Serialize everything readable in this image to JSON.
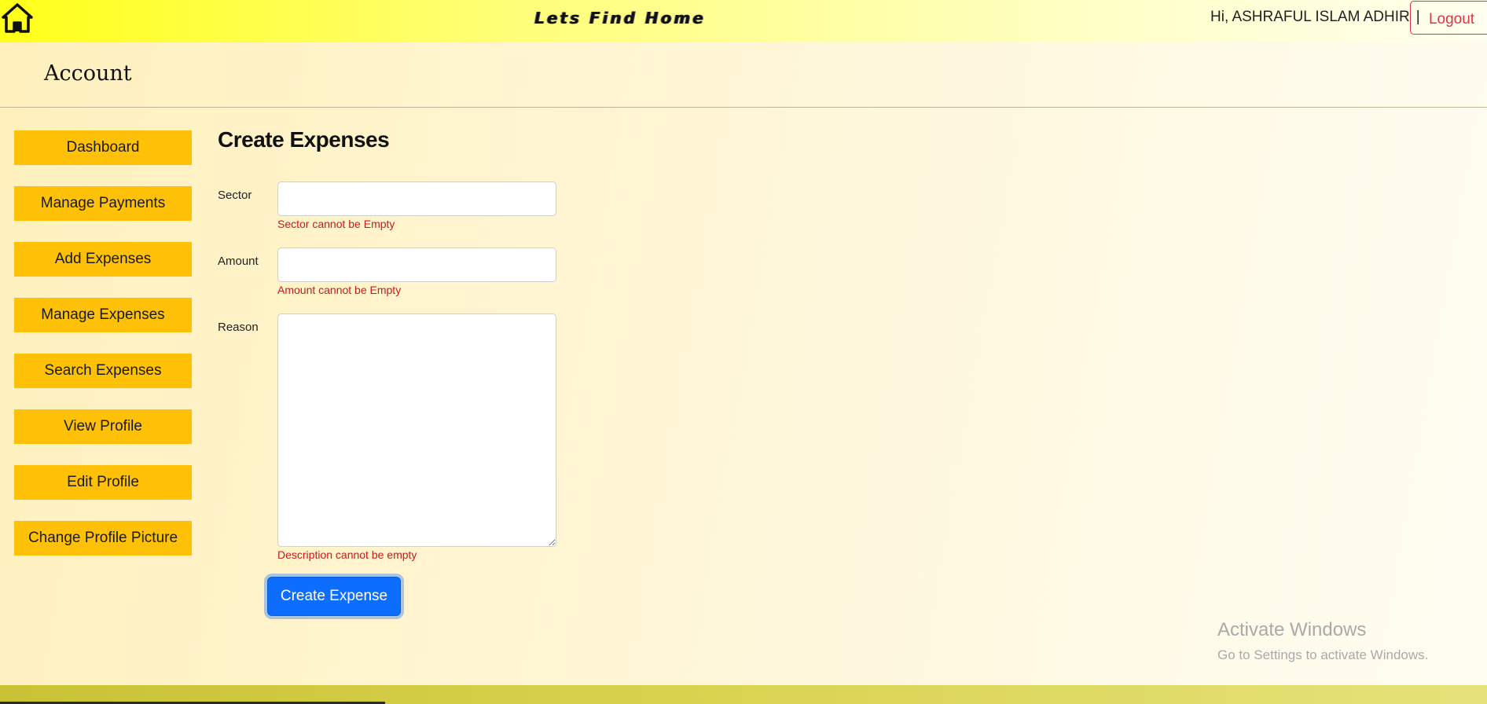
{
  "header": {
    "brand": "Lets Find Home",
    "greeting": "Hi, ASHRAFUL ISLAM ADHIR",
    "separator": "|",
    "logout_label": "Logout",
    "home_icon": "home-icon"
  },
  "page": {
    "section_title": "Account"
  },
  "sidebar": {
    "items": [
      {
        "label": "Dashboard"
      },
      {
        "label": "Manage Payments"
      },
      {
        "label": "Add Expenses"
      },
      {
        "label": "Manage Expenses"
      },
      {
        "label": "Search Expenses"
      },
      {
        "label": "View Profile"
      },
      {
        "label": "Edit Profile"
      },
      {
        "label": "Change Profile Picture"
      }
    ]
  },
  "form": {
    "title": "Create Expenses",
    "sector": {
      "label": "Sector",
      "value": "",
      "error": "Sector cannot be Empty"
    },
    "amount": {
      "label": "Amount",
      "value": "",
      "error": "Amount cannot be Empty"
    },
    "reason": {
      "label": "Reason",
      "value": "",
      "error": "Description cannot be empty"
    },
    "submit_label": "Create Expense"
  },
  "watermark": {
    "line1": "Activate Windows",
    "line2": "Go to Settings to activate Windows."
  },
  "colors": {
    "accent_button": "#ffc107",
    "primary_button": "#0d6efd",
    "error_text": "#c41c1c",
    "logout": "#dc3545"
  }
}
